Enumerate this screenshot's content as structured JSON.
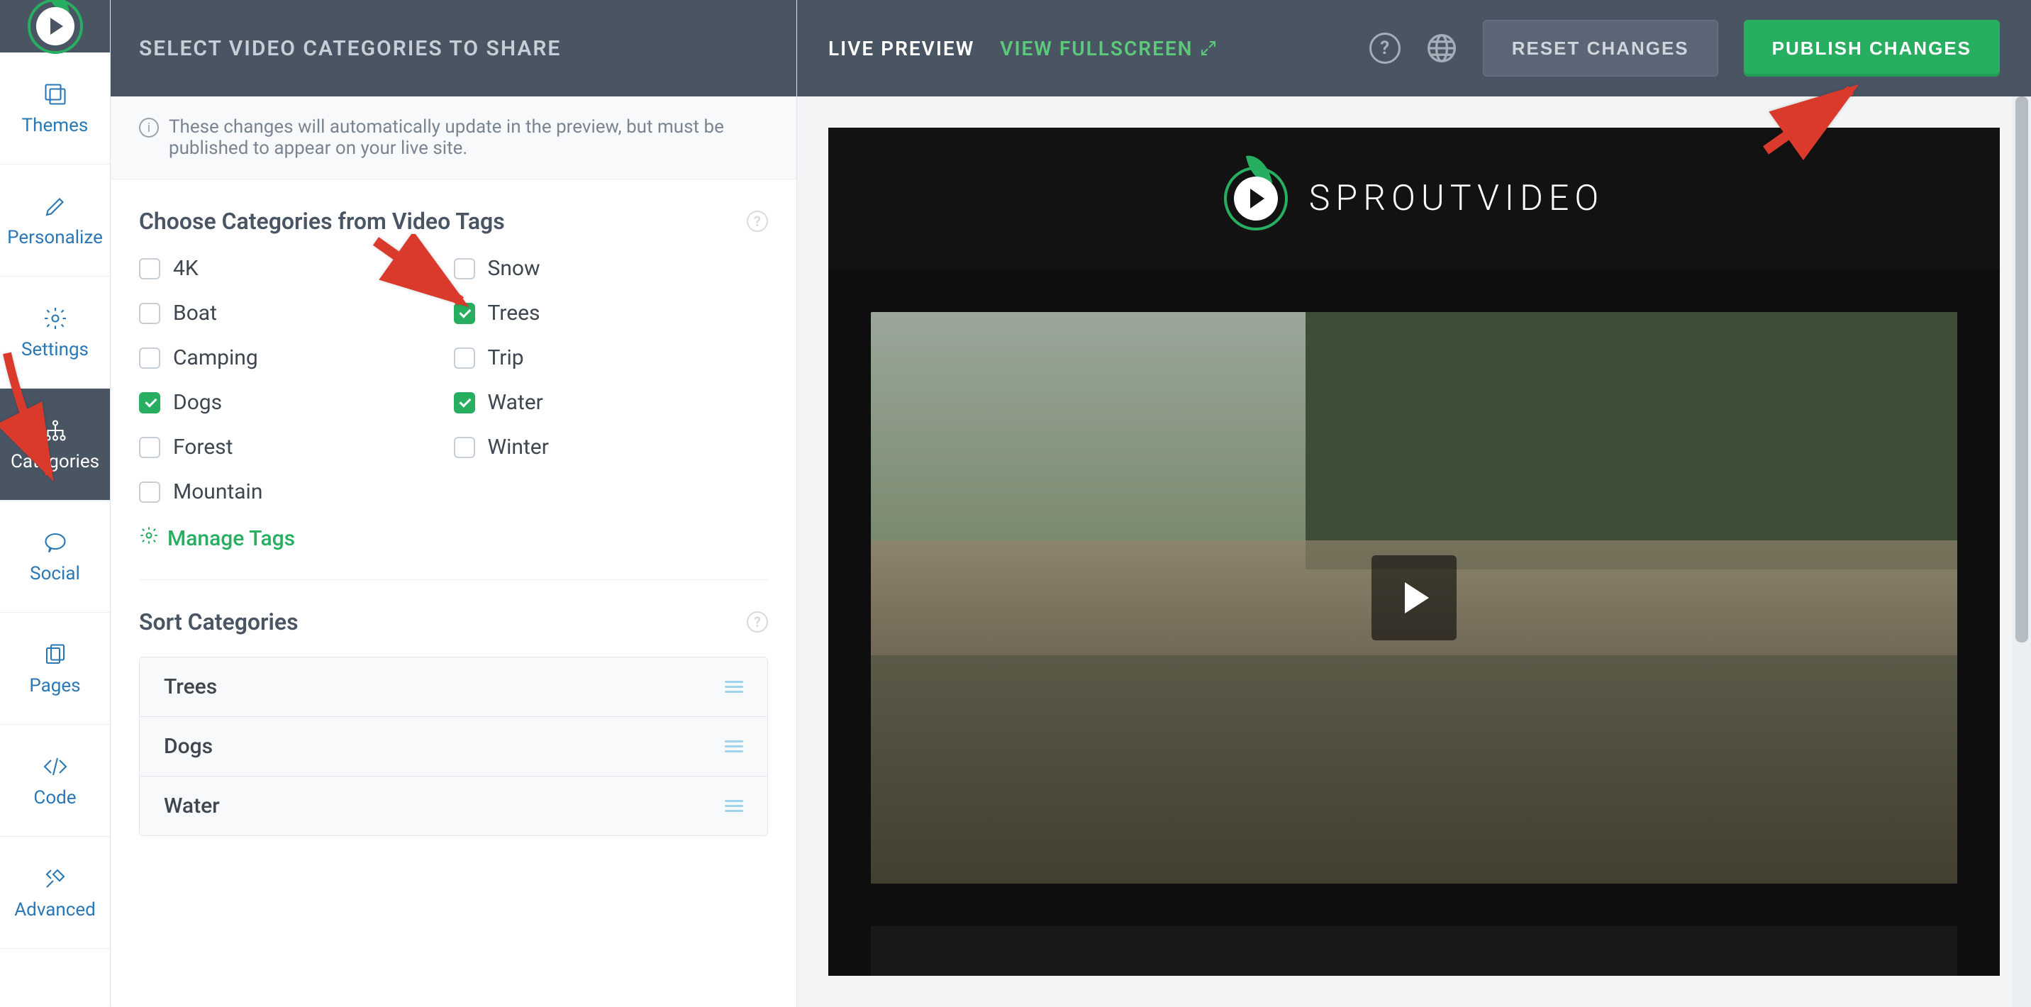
{
  "colors": {
    "accent_green": "#27ae60",
    "header_bg": "#4a5564",
    "text_muted": "#7a8591",
    "link_blue": "#2978b5",
    "danger_red": "#d93a2b"
  },
  "brand": {
    "product_name": "SPROUTVIDEO"
  },
  "sidebar": {
    "items": [
      {
        "label": "Themes",
        "name": "sidebar-item-themes",
        "active": false
      },
      {
        "label": "Personalize",
        "name": "sidebar-item-personalize",
        "active": false
      },
      {
        "label": "Settings",
        "name": "sidebar-item-settings",
        "active": false
      },
      {
        "label": "Categories",
        "name": "sidebar-item-categories",
        "active": true
      },
      {
        "label": "Social",
        "name": "sidebar-item-social",
        "active": false
      },
      {
        "label": "Pages",
        "name": "sidebar-item-pages",
        "active": false
      },
      {
        "label": "Code",
        "name": "sidebar-item-code",
        "active": false
      },
      {
        "label": "Advanced",
        "name": "sidebar-item-advanced",
        "active": false
      }
    ]
  },
  "panel": {
    "title": "SELECT VIDEO CATEGORIES TO SHARE",
    "info_text": "These changes will automatically update in the preview, but must be published to appear on your live site.",
    "choose_title": "Choose Categories from Video Tags",
    "manage_tags_label": "Manage Tags",
    "sort_title": "Sort Categories",
    "categories": [
      {
        "label": "4K",
        "checked": false
      },
      {
        "label": "Snow",
        "checked": false
      },
      {
        "label": "Boat",
        "checked": false
      },
      {
        "label": "Trees",
        "checked": true
      },
      {
        "label": "Camping",
        "checked": false
      },
      {
        "label": "Trip",
        "checked": false
      },
      {
        "label": "Dogs",
        "checked": true
      },
      {
        "label": "Water",
        "checked": true
      },
      {
        "label": "Forest",
        "checked": false
      },
      {
        "label": "Winter",
        "checked": false
      },
      {
        "label": "Mountain",
        "checked": false
      }
    ],
    "sort_items": [
      {
        "label": "Trees"
      },
      {
        "label": "Dogs"
      },
      {
        "label": "Water"
      }
    ]
  },
  "preview_header": {
    "live_preview": "LIVE PREVIEW",
    "view_fullscreen": "VIEW FULLSCREEN",
    "reset": "RESET CHANGES",
    "publish": "PUBLISH CHANGES"
  }
}
